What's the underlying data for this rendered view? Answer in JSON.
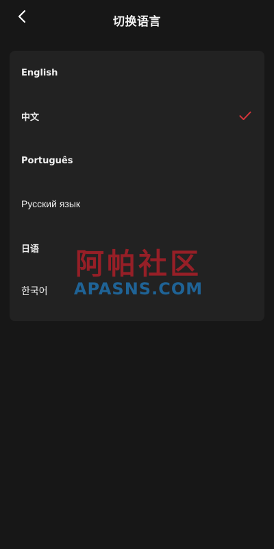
{
  "header": {
    "title": "切换语言",
    "back_icon": "chevron-left-icon"
  },
  "languages": [
    {
      "label": "English",
      "selected": false
    },
    {
      "label": "中文",
      "selected": true
    },
    {
      "label": "Português",
      "selected": false
    },
    {
      "label": "Русский язык",
      "selected": false
    },
    {
      "label": "日语",
      "selected": false
    },
    {
      "label": "한국어",
      "selected": false
    }
  ],
  "check_icon": "checkmark-icon",
  "watermark": {
    "line1": "阿帕社区",
    "line2": "APASNS.COM"
  },
  "colors": {
    "background": "#171717",
    "card": "#222222",
    "text": "#f0f0f0",
    "check": "#d0343a",
    "watermark_red": "#aa1e28",
    "watermark_blue": "#1e6eaa"
  }
}
